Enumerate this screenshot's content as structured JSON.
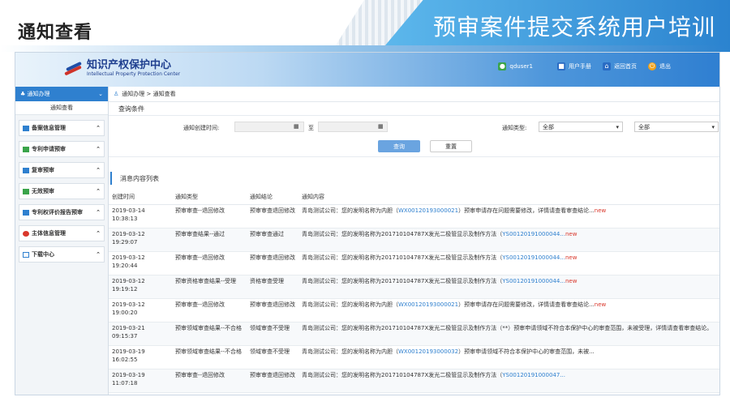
{
  "slide": {
    "title": "通知查看",
    "banner": "预审案件提交系统用户培训"
  },
  "header": {
    "logo_cn": "知识产权保护中心",
    "logo_en": "Intellectual Property Protection Center",
    "user": "qduser1",
    "manual": "用户手册",
    "home": "返回首页",
    "logout": "退出"
  },
  "sidebar": {
    "active": "通知办理",
    "active_sub": "通知查看",
    "items": [
      "备案信息管理",
      "专利申请预审",
      "复审预审",
      "无效预审",
      "专利权评价报告预审",
      "主体信息管理",
      "下载中心"
    ]
  },
  "breadcrumb": "通知办理 > 通知查看",
  "query": {
    "title": "查询条件",
    "created_label": "通知创建时间:",
    "to_label": "至",
    "type_label": "通知类型:",
    "type_value": "全部",
    "type_value2": "全部",
    "search": "查询",
    "reset": "重置"
  },
  "list": {
    "title": "消息内容列表",
    "columns": [
      "创建时间",
      "通知类型",
      "通知结论",
      "通知内容"
    ],
    "rows": [
      {
        "time": "2019-03-14 10:38:13",
        "type": "预审审查--退回修改",
        "result": "预审审查退回修改",
        "pre": "青岛测试公司：您的发明名称为内胆（",
        "code": "WX00120193000021",
        "post": "）预审申请存在问题需要修改，详情请查看审查结论...",
        "new": "new"
      },
      {
        "time": "2019-03-12 19:29:07",
        "type": "预审审查结果--通过",
        "result": "预审审查通过",
        "pre": "青岛测试公司：您的发明名称为201710104787X发光二极管显示及制作方法（",
        "code": "YS00120191000044...",
        "post": "",
        "new": "new"
      },
      {
        "time": "2019-03-12 19:20:44",
        "type": "预审审查--退回修改",
        "result": "预审审查退回修改",
        "pre": "青岛测试公司：您的发明名称为201710104787X发光二极管显示及制作方法（",
        "code": "YS00120191000044...",
        "post": "",
        "new": "new"
      },
      {
        "time": "2019-03-12 19:19:12",
        "type": "预审资格审查结果--受理",
        "result": "资格审查受理",
        "pre": "青岛测试公司：您的发明名称为201710104787X发光二极管显示及制作方法（",
        "code": "YS00120191000044...",
        "post": "",
        "new": "new"
      },
      {
        "time": "2019-03-12 19:00:20",
        "type": "预审审查--退回修改",
        "result": "预审审查退回修改",
        "pre": "青岛测试公司：您的发明名称为内胆（",
        "code": "WX00120193000021",
        "post": "）预审申请存在问题需要修改，详情请查看审查结论...",
        "new": "new"
      },
      {
        "time": "2019-03-21 09:15:37",
        "type": "预审领域审查结果--不合格",
        "result": "领域审查不受理",
        "pre": "青岛测试公司：您的发明名称为201710104787X发光二极管显示及制作方法（**）预审申请领域不符合本保护中心的审查范围，未被受理，详情请查看审查结论。",
        "code": "",
        "post": "",
        "new": ""
      },
      {
        "time": "2019-03-19 16:02:55",
        "type": "预审领域审查结果--不合格",
        "result": "领域审查不受理",
        "pre": "青岛测试公司：您的发明名称为内胆（",
        "code": "WX00120193000032",
        "post": "）预审申请领域不符合本保护中心的审查范围，未被...",
        "new": ""
      },
      {
        "time": "2019-03-19 11:07:18",
        "type": "预审审查--退回修改",
        "result": "预审审查退回修改",
        "pre": "青岛测试公司：您的发明名称为201710104787X发光二极管显示及制作方法（",
        "code": "YS00120191000047...",
        "post": "",
        "new": ""
      }
    ]
  },
  "colors": {
    "accent": "#2f80cf",
    "new": "#d9372b"
  }
}
